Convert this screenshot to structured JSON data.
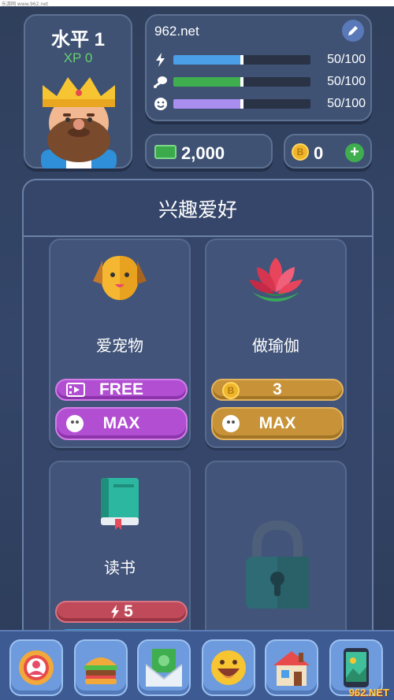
{
  "source_strip": "乐游网 www.962.net",
  "player": {
    "level_label": "水平 1",
    "xp_label": "XP 0"
  },
  "stats": {
    "site": "962.net",
    "bars": [
      {
        "icon": "lightning-icon",
        "value": "50/100",
        "fraction": 0.5,
        "color": "#4a9fe8"
      },
      {
        "icon": "drumstick-icon",
        "value": "50/100",
        "fraction": 0.5,
        "color": "#3fae4f"
      },
      {
        "icon": "smile-icon",
        "value": "50/100",
        "fraction": 0.5,
        "color": "#a98ef0"
      }
    ]
  },
  "currency": {
    "cash": "2,000",
    "coins": "0"
  },
  "hobbies": {
    "title": "兴趣爱好",
    "items": [
      {
        "name": "爱宠物",
        "icon": "dog-icon",
        "cost_label": "FREE",
        "cost_icon": "video-icon",
        "cost_style": "purple",
        "level_label": "MAX",
        "level_style": "purple"
      },
      {
        "name": "做瑜伽",
        "icon": "lotus-icon",
        "cost_label": "3",
        "cost_icon": "coin-icon",
        "cost_style": "gold",
        "level_label": "MAX",
        "level_style": "gold"
      },
      {
        "name": "读书",
        "icon": "book-icon",
        "cost_label": "5",
        "cost_icon": "lightning-icon",
        "cost_style": "red",
        "level_label": "",
        "level_style": "blue"
      },
      {
        "name": "",
        "icon": "lock-icon",
        "locked": true
      }
    ]
  },
  "nav": [
    "profile-icon",
    "burger-icon",
    "money-mail-icon",
    "emoji-icon",
    "house-icon",
    "phone-icon"
  ],
  "watermark": "962.NET"
}
